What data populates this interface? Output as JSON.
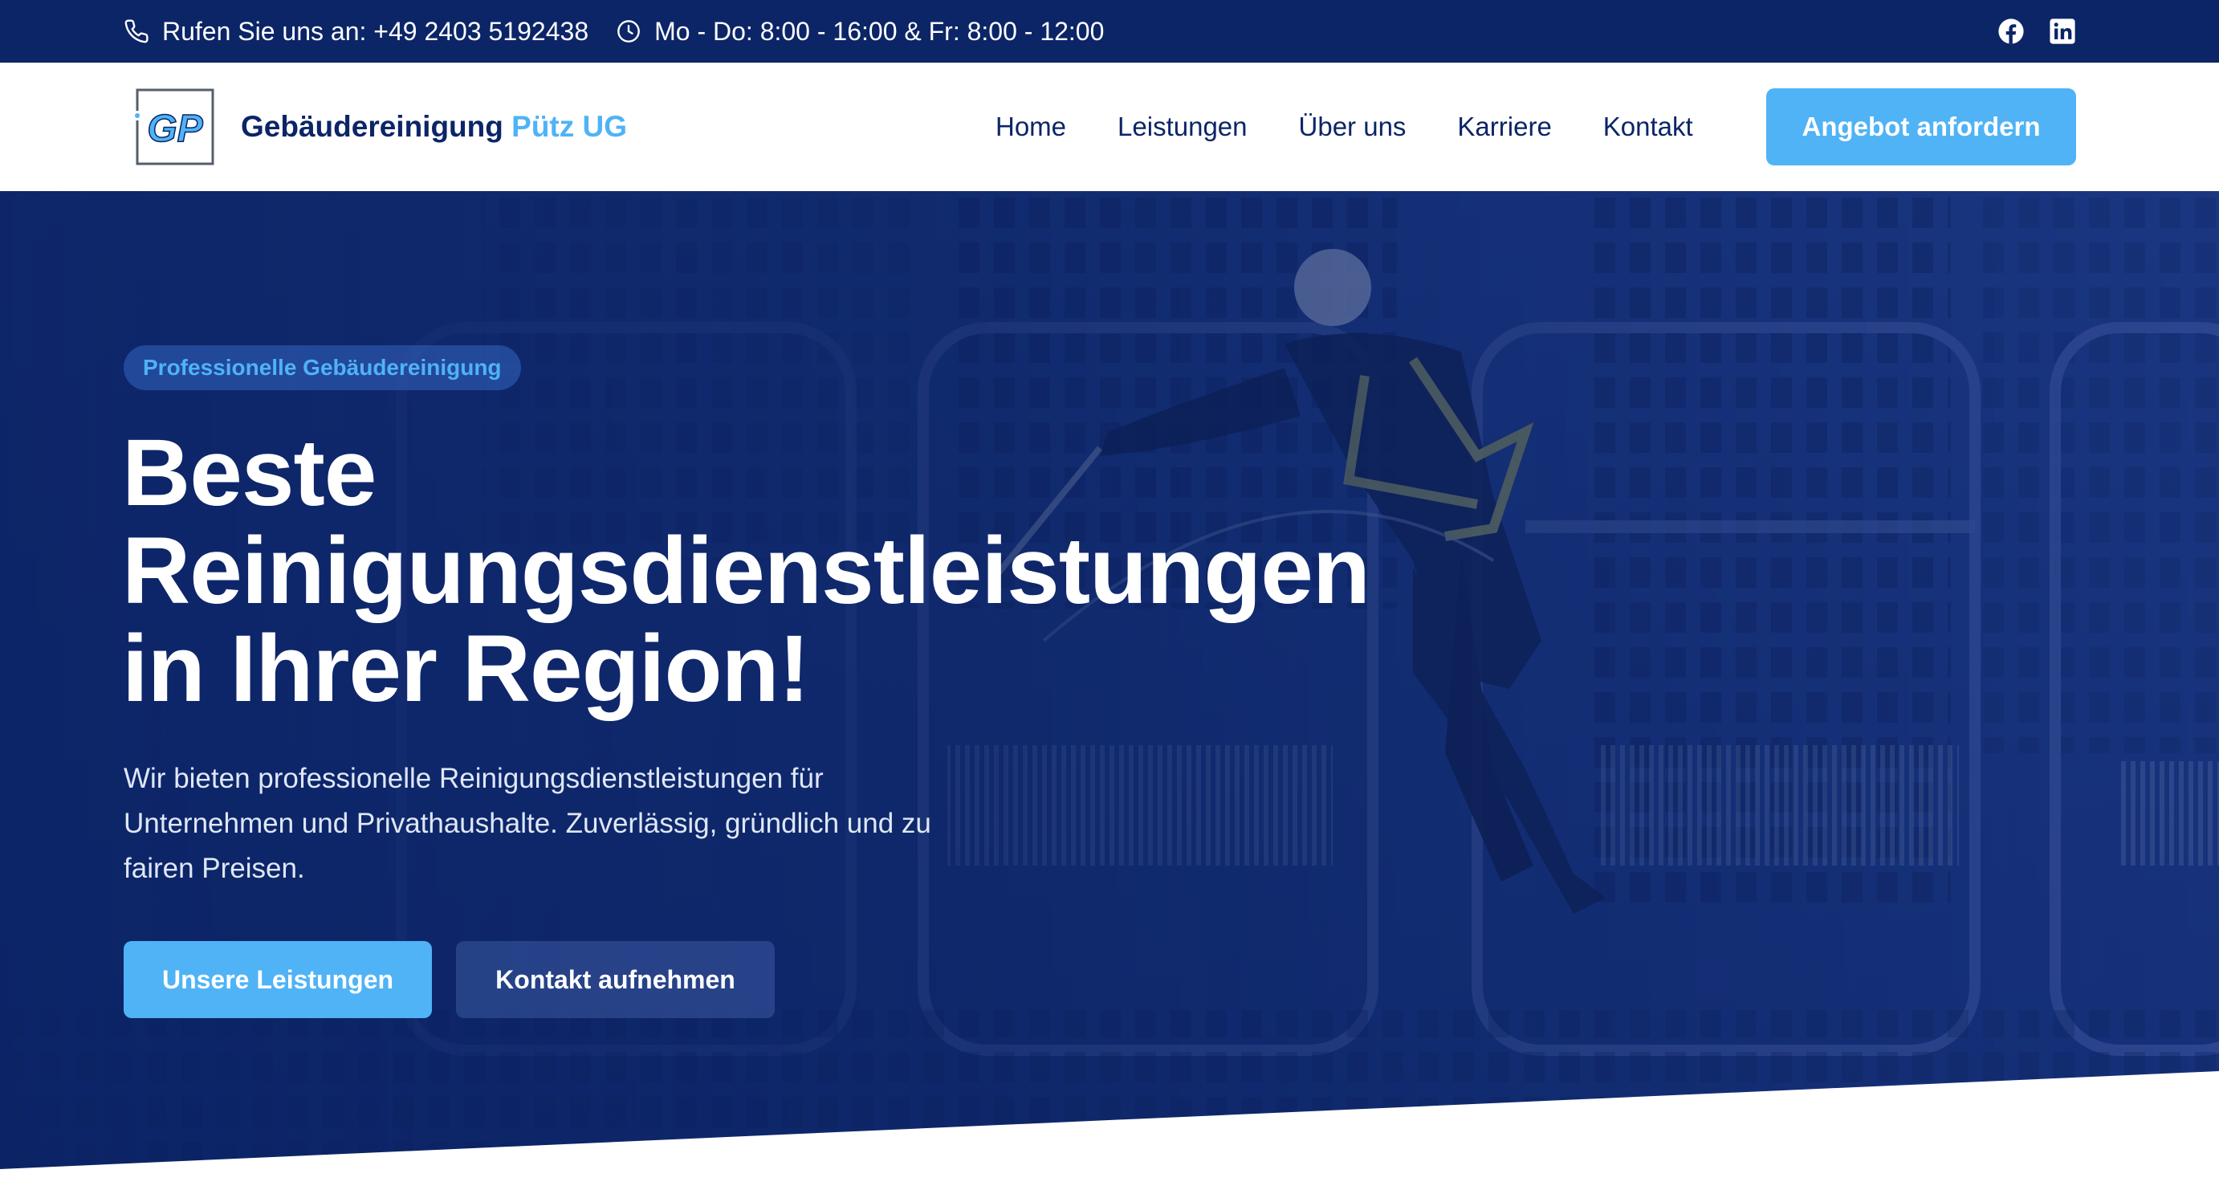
{
  "topbar": {
    "phone_text": "Rufen Sie uns an: +49 2403 5192438",
    "hours_text": "Mo - Do: 8:00 - 16:00 & Fr: 8:00 - 12:00",
    "icons": {
      "phone": "phone-icon",
      "hours": "clock-icon"
    },
    "social": [
      "facebook-icon",
      "linkedin-icon"
    ]
  },
  "brand": {
    "logo_letters": "GP",
    "name": "Gebäudereinigung",
    "name_accent": "Pütz UG"
  },
  "nav": {
    "items": [
      {
        "label": "Home"
      },
      {
        "label": "Leistungen"
      },
      {
        "label": "Über uns"
      },
      {
        "label": "Karriere"
      },
      {
        "label": "Kontakt"
      }
    ],
    "cta_label": "Angebot anfordern"
  },
  "hero": {
    "badge": "Professionelle Gebäudereinigung",
    "title_lines": [
      "Beste",
      "Reinigungsdienstleistungen",
      "in Ihrer Region!"
    ],
    "text": "Wir bieten professionelle Reinigungsdienstleistungen für Unternehmen und Privathaushalte. Zuverlässig, gründlich und zu fairen Preisen.",
    "primary_button": "Unsere Leistungen",
    "secondary_button": "Kontakt aufnehmen"
  },
  "colors": {
    "navy": "#0b2567",
    "accent": "#4fb3f6",
    "white": "#ffffff"
  }
}
